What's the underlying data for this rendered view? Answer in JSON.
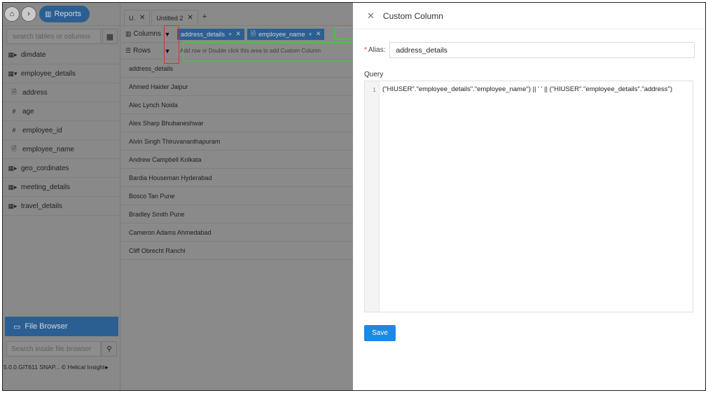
{
  "topnav": {
    "home_icon": "home-icon",
    "reports_label": "Reports"
  },
  "left": {
    "search_placeholder": "search tables or columns",
    "tree": [
      {
        "label": "dimdate",
        "icon": "▦▸"
      },
      {
        "label": "employee_details",
        "icon": "▦▾"
      },
      {
        "label": "address",
        "icon": "🗎"
      },
      {
        "label": "age",
        "icon": "#"
      },
      {
        "label": "employee_id",
        "icon": "#"
      },
      {
        "label": "employee_name",
        "icon": "🗎"
      },
      {
        "label": "geo_cordinates",
        "icon": "▦▸"
      },
      {
        "label": "meeting_details",
        "icon": "▦▸"
      },
      {
        "label": "travel_details",
        "icon": "▦▸"
      }
    ],
    "file_browser_label": "File Browser",
    "file_search_placeholder": "Search inside file browser",
    "version": "5.0.0.GIT611 SNAP...",
    "copyright": "© Helical Insight"
  },
  "mid": {
    "tabs": [
      {
        "label": "U."
      },
      {
        "label": "Untitled 2"
      }
    ],
    "tab_add": "+",
    "columns_label": "Columns",
    "rows_label": "Rows",
    "chips": [
      {
        "label": "address_details"
      },
      {
        "label": "employee_name"
      }
    ],
    "rows_hint": "Add row or Double click this area to add Custom Column",
    "grid_header": "address_details",
    "grid_rows": [
      "Ahmed Haider Jaipur",
      "Alec Lynch Noida",
      "Alex Sharp Bhubaneshwar",
      "Alvin Singh Thiruvananthapuram",
      "Andrew Campbell Kolkata",
      "Bardia Houseman Hyderabad",
      "Bosco Tan Pune",
      "Bradley Smith Pune",
      "Cameron Adams Ahmedabad",
      "Cliff Obrecht Ranchi"
    ]
  },
  "panel": {
    "title": "Custom Column",
    "alias_required": "*",
    "alias_label": "Alias:",
    "alias_value": "address_details",
    "query_label": "Query",
    "line_number": "1",
    "query_code": "(\"HIUSER\".\"employee_details\".\"employee_name\") || ' ' || (\"HIUSER\".\"employee_details\".\"address\")",
    "save_label": "Save"
  }
}
